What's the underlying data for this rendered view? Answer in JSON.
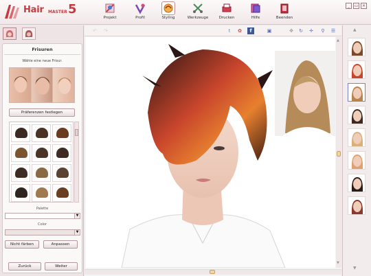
{
  "app": {
    "logo_hair": "Hair",
    "logo_master": "MASTER",
    "logo_version": "5"
  },
  "toolbar": {
    "items": [
      {
        "label": "Projekt",
        "icon": "projekt-icon"
      },
      {
        "label": "Profil",
        "icon": "profil-icon"
      },
      {
        "label": "Styling",
        "icon": "styling-icon",
        "active": true
      },
      {
        "label": "Werkzeuge",
        "icon": "werkzeuge-icon"
      },
      {
        "label": "Drucken",
        "icon": "drucken-icon"
      },
      {
        "label": "Hilfe",
        "icon": "hilfe-icon"
      },
      {
        "label": "Beenden",
        "icon": "beenden-icon"
      }
    ]
  },
  "window_controls": {
    "minimize": "_",
    "restore": "▭",
    "close": "×"
  },
  "left_panel": {
    "title": "Frisuren",
    "subtitle": "Wähle eine neue Frisur.",
    "preferences_button": "Präferenzen festlegen",
    "palette_label": "Palette",
    "color_label": "Color",
    "btn_not_color": "Nicht färben",
    "btn_adjust": "Anpassen",
    "btn_back": "Zurück",
    "btn_next": "Weiter"
  },
  "colors": {
    "accent": "#c53a3f",
    "panel_bg": "#eee4e5",
    "card_bg": "#fbf8f8",
    "wig_colors": [
      "#3a2a22",
      "#4a3324",
      "#6a3d22",
      "#7a5530",
      "#4b3427",
      "#3d2b24",
      "#3c2c23",
      "#8a6a45",
      "#5a4330",
      "#2e2420",
      "#a07a4e",
      "#6b3f22"
    ]
  }
}
